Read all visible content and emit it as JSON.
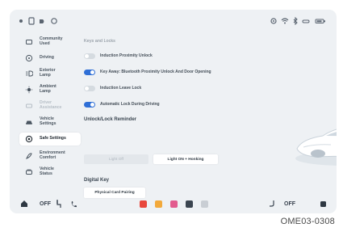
{
  "sidebar": {
    "items": [
      {
        "label": "Community\nUsed",
        "icon": "community-icon",
        "active": false,
        "disabled": false
      },
      {
        "label": "Driving",
        "icon": "steering-wheel-icon",
        "active": false,
        "disabled": false
      },
      {
        "label": "Exterior\nLamp",
        "icon": "exterior-lamp-icon",
        "active": false,
        "disabled": false
      },
      {
        "label": "Ambient\nLamp",
        "icon": "ambient-lamp-icon",
        "active": false,
        "disabled": false
      },
      {
        "label": "Driver\nAssistance",
        "icon": "driver-assistance-icon",
        "active": false,
        "disabled": true
      },
      {
        "label": "Vehicle\nSettings",
        "icon": "vehicle-icon",
        "active": false,
        "disabled": false
      },
      {
        "label": "Safe Settings",
        "icon": "safe-settings-icon",
        "active": true,
        "disabled": false
      },
      {
        "label": "Environment\nComfort",
        "icon": "environment-comfort-icon",
        "active": false,
        "disabled": false
      },
      {
        "label": "Vehicle\nStatus",
        "icon": "vehicle-status-icon",
        "active": false,
        "disabled": false
      }
    ]
  },
  "content": {
    "heading": "Keys and Locks",
    "toggles": [
      {
        "label": "Induction Proximity Unlock",
        "on": false
      },
      {
        "label": "Key Away: Bluetooth Proximity Unlock And Door Opening",
        "on": true
      },
      {
        "label": "Induction Leave Lock",
        "on": false
      },
      {
        "label": "Automatic Lock During Driving",
        "on": true
      }
    ],
    "reminder_title": "Unlock/Lock Reminder",
    "reminder_options": [
      {
        "label": "Light Off",
        "selected": false
      },
      {
        "label": "Light ON + Honking",
        "selected": true
      }
    ],
    "digital_key_title": "Digital Key",
    "physical_card_button": "Physical Card Pairing"
  },
  "dock": {
    "left_climate": "OFF",
    "right_climate": "OFF",
    "app_colors": [
      "#e8473c",
      "#f2a93b",
      "#e25b8e",
      "#3b4550",
      "#c9ced4"
    ]
  },
  "colors": {
    "accent": "#2f6fd6",
    "background": "#eef1f4"
  },
  "caption": "OME03-0308"
}
